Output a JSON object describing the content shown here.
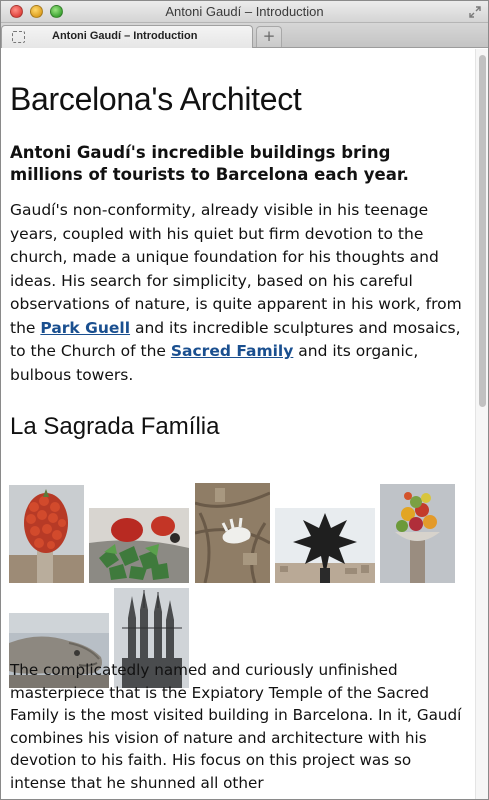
{
  "window": {
    "title": "Antoni Gaudí – Introduction",
    "tab_title": "Antoni Gaudí – Introduction",
    "new_tab_label": "+"
  },
  "page": {
    "heading": "Barcelona's Architect",
    "lead": "Antoni Gaudí's incredible buildings bring millions of tourists to Barcelona each year.",
    "para1": {
      "t1": "Gaudí's non-conformity, already visible in his teenage years, coupled with his quiet but firm devotion to the church, made a unique foundation for his thoughts and ideas. His search for simplicity, based on his careful observations of nature, is quite apparent in his work, from the ",
      "link1": "Park Guell",
      "t2": " and its incredible sculptures and mosaics, to the Church of the ",
      "link2": "Sacred Family",
      "t3": " and its organic, bulbous towers."
    },
    "subheading": "La Sagrada Família",
    "para2": "The complicatedly named and curiously unfinished masterpiece that is the Expiatory Temple of the Sacred Family is the most visited building in Barcelona. In it, Gaudí combines his vision of nature and architecture with his devotion to his faith. His focus on this project was so intense that he shunned all other"
  },
  "colors": {
    "link": "#1a4f8f",
    "text": "#111111"
  },
  "icons": [
    "fullscreen-icon",
    "page-favicon-icon"
  ]
}
